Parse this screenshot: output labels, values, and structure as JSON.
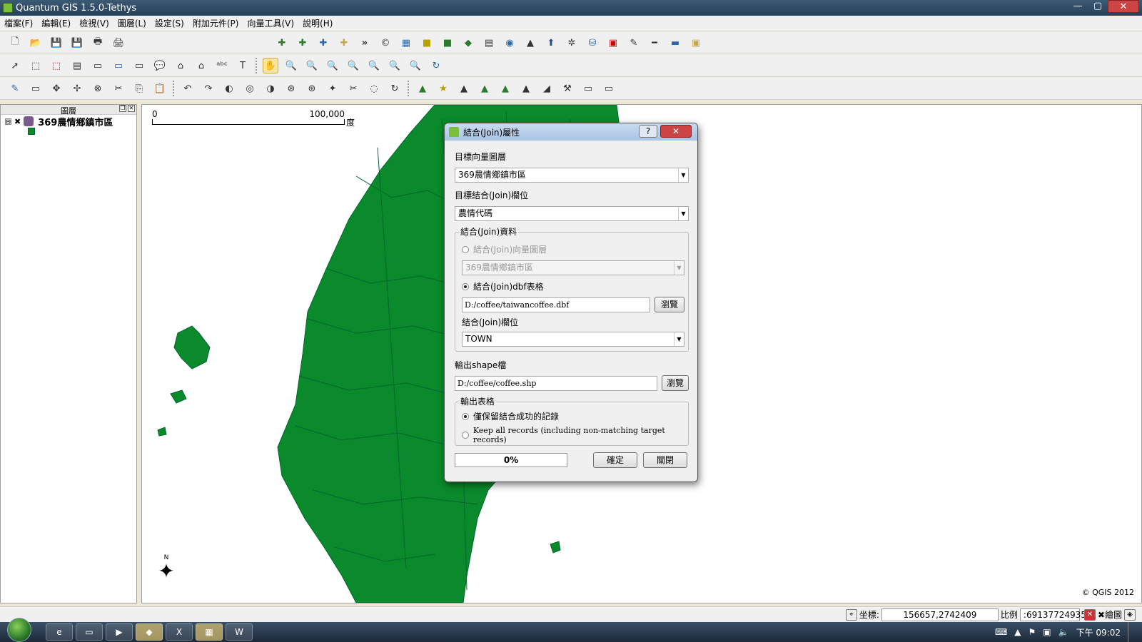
{
  "window": {
    "title": "Quantum GIS 1.5.0-Tethys",
    "min": "—",
    "max": "▢",
    "close": "✕"
  },
  "menu": [
    "檔案(F)",
    "編輯(E)",
    "檢視(V)",
    "圖層(L)",
    "設定(S)",
    "附加元件(P)",
    "向量工具(V)",
    "說明(H)"
  ],
  "toolbar1": {
    "overflow": "»"
  },
  "legend": {
    "title": "圖層",
    "layer_name": "369農情鄉鎮市區",
    "expand": "⊟",
    "check": "✖"
  },
  "map": {
    "scale_start": "0",
    "scale_end": "100,000",
    "scale_unit": "度",
    "north": "N",
    "copyright": "© QGIS 2012",
    "fill_color": "#0a8a2a"
  },
  "dialog": {
    "title": "結合(Join)屬性",
    "help": "?",
    "close": "✕",
    "target_layer_label": "目標向量圖層",
    "target_layer_value": "369農情鄉鎮市區",
    "target_field_label": "目標結合(Join)欄位",
    "target_field_value": "農情代碼",
    "join_data_group": "結合(Join)資料",
    "join_vector_radio": "結合(Join)向量圖層",
    "join_vector_value": "369農情鄉鎮市區",
    "join_dbf_radio": "結合(Join)dbf表格",
    "dbf_path": "D:/coffee/taiwancoffee.dbf",
    "browse": "瀏覽",
    "join_field_label": "結合(Join)欄位",
    "join_field_value": "TOWN",
    "output_label": "輸出shape檔",
    "output_path": "D:/coffee/coffee.shp",
    "output_table_group": "輸出表格",
    "keep_matched": "僅保留結合成功的記錄",
    "keep_all": "Keep all records (including non-matching target records)",
    "progress": "0%",
    "ok": "確定",
    "close_btn": "關閉"
  },
  "status": {
    "coord_label": "坐標:",
    "coord_value": "156657,2742409",
    "scale_label": "比例",
    "scale_value": ":69137724935",
    "render_label": "繪圖"
  },
  "taskbar": {
    "time": "下午 09:02"
  }
}
